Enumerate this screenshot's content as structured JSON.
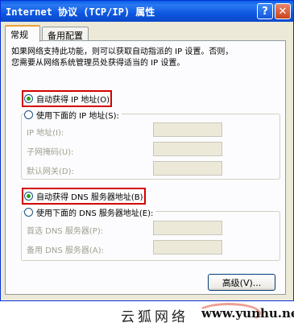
{
  "window": {
    "title": "Internet 协议 (TCP/IP) 属性",
    "help_glyph": "?",
    "close_glyph": "✕"
  },
  "tabs": [
    {
      "label": "常规"
    },
    {
      "label": "备用配置"
    }
  ],
  "description": "如果网络支持此功能，则可以获取自动指派的 IP 设置。否则，\n您需要从网络系统管理员处获得适当的 IP 设置。",
  "ip": {
    "auto_label": "自动获得 IP 地址(O)",
    "manual_label": "使用下面的 IP 地址(S):",
    "fields": [
      {
        "label": "IP 地址(I):",
        "value": ""
      },
      {
        "label": "子网掩码(U):",
        "value": ""
      },
      {
        "label": "默认网关(D):",
        "value": ""
      }
    ]
  },
  "dns": {
    "auto_label": "自动获得 DNS 服务器地址(B)",
    "manual_label": "使用下面的 DNS 服务器地址(E):",
    "fields": [
      {
        "label": "首选 DNS 服务器(P):",
        "value": ""
      },
      {
        "label": "备用 DNS 服务器(A):",
        "value": ""
      }
    ]
  },
  "advanced_button": "高级(V)...",
  "watermark": {
    "cn": "云狐网络",
    "url": "www.yunhu.net"
  },
  "colors": {
    "titlebar": "#0a5fe8",
    "highlight": "#d40000",
    "radio_dot": "#21a121"
  }
}
